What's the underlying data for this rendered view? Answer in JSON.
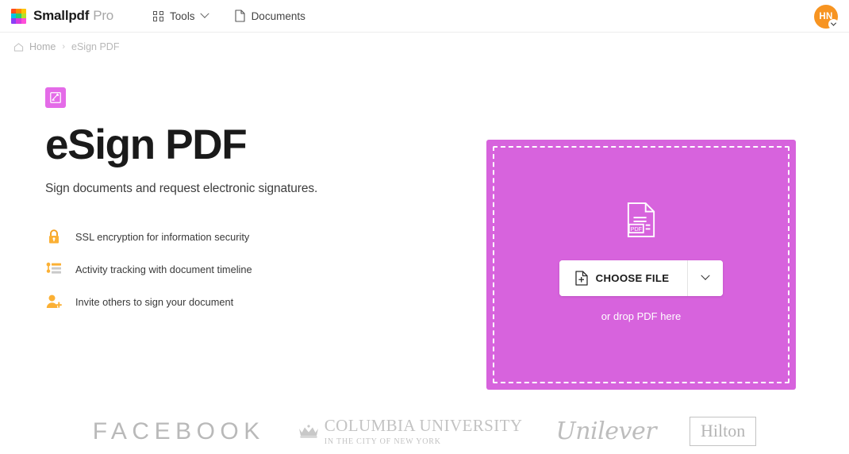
{
  "header": {
    "brand_name": "Smallpdf",
    "brand_suffix": "Pro",
    "logo_colors": [
      "#ff4d1c",
      "#ff8a00",
      "#ffc400",
      "#00c2e8",
      "#27d06d",
      "#b6e02a",
      "#8b3ff5",
      "#d63ce0",
      "#ff4fd8"
    ],
    "nav": [
      {
        "label": "Tools",
        "icon": "grid-icon",
        "has_caret": true
      },
      {
        "label": "Documents",
        "icon": "document-icon",
        "has_caret": false
      }
    ],
    "avatar": {
      "initials": "HN",
      "color": "#f79421"
    }
  },
  "breadcrumb": {
    "home_label": "Home",
    "separator": "›",
    "current_label": "eSign PDF"
  },
  "main": {
    "tool_icon_name": "esign-badge-icon",
    "tool_icon_color": "#e46be8",
    "title": "eSign PDF",
    "subtitle": "Sign documents and request electronic signatures.",
    "features": [
      {
        "icon": "lock-icon",
        "label": "SSL encryption for information security"
      },
      {
        "icon": "timeline-list-icon",
        "label": "Activity tracking with document timeline"
      },
      {
        "icon": "person-add-icon",
        "label": "Invite others to sign your document"
      }
    ]
  },
  "dropzone": {
    "background_color": "#d763dd",
    "file_icon_name": "pdf-document-icon",
    "file_icon_label": "PDF",
    "choose_file_label": "CHOOSE FILE",
    "dropdown_icon": "chevron-down-icon",
    "drop_hint": "or drop PDF here"
  },
  "logos": [
    {
      "name": "facebook",
      "text": "FACEBOOK"
    },
    {
      "name": "columbia-university",
      "text": "COLUMBIA UNIVERSITY",
      "subtext": "IN THE CITY OF NEW YORK"
    },
    {
      "name": "unilever",
      "text": "Unilever"
    },
    {
      "name": "hilton",
      "text": "Hilton"
    }
  ]
}
